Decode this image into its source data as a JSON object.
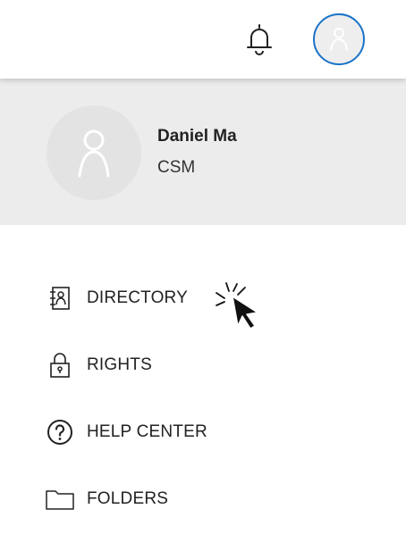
{
  "header": {
    "notifications_icon": "bell-icon",
    "avatar_icon": "user-icon",
    "accent_color": "#1a73c8"
  },
  "profile": {
    "name": "Daniel Ma",
    "role": "CSM",
    "avatar_icon": "user-icon",
    "background_color": "#ececec"
  },
  "menu": {
    "items": [
      {
        "label": "DIRECTORY",
        "icon": "directory-icon"
      },
      {
        "label": "RIGHTS",
        "icon": "lock-icon"
      },
      {
        "label": "HELP CENTER",
        "icon": "help-icon"
      },
      {
        "label": "FOLDERS",
        "icon": "folder-icon"
      }
    ]
  }
}
